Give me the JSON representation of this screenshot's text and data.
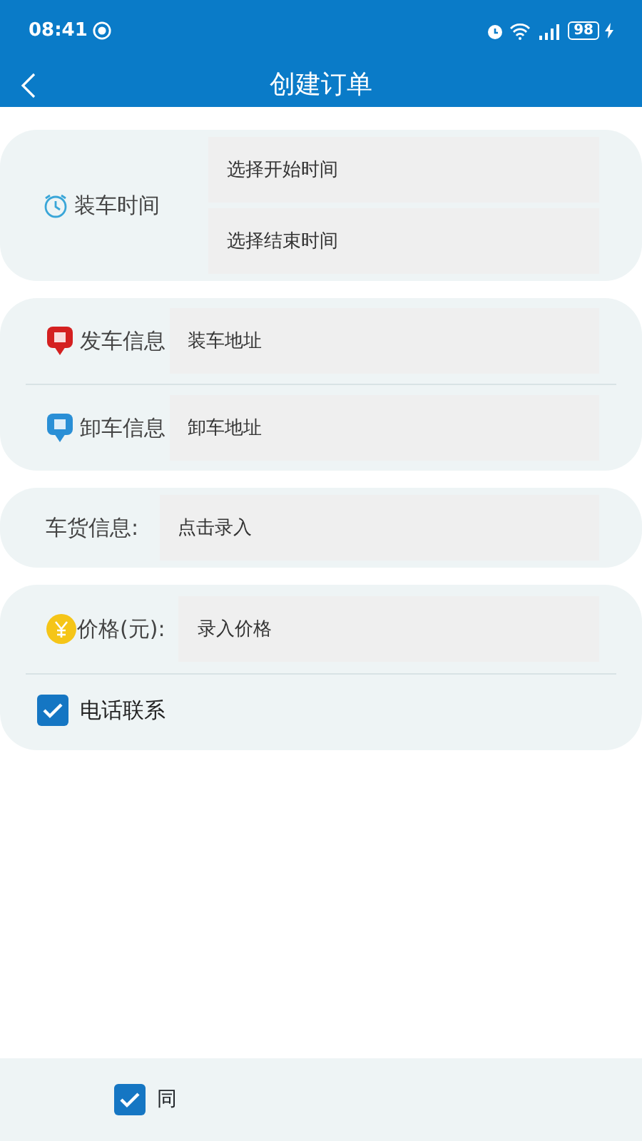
{
  "status_bar": {
    "time": "08:41",
    "battery": "98"
  },
  "title": "创建订单",
  "load_time": {
    "label": "装车时间",
    "start_placeholder": "选择开始时间",
    "end_placeholder": "选择结束时间"
  },
  "addresses": [
    {
      "kind": "depart",
      "label": "发车信息",
      "placeholder": "装车地址"
    },
    {
      "kind": "unload",
      "label": "卸车信息",
      "placeholder": "卸车地址"
    }
  ],
  "cargo": {
    "label": "车货信息:",
    "placeholder": "点击录入"
  },
  "price": {
    "label": "价格(元):",
    "placeholder": "录入价格"
  },
  "phone_contact": {
    "label": "电话联系",
    "checked": true
  },
  "agreement": {
    "label": "同",
    "checked": true
  }
}
